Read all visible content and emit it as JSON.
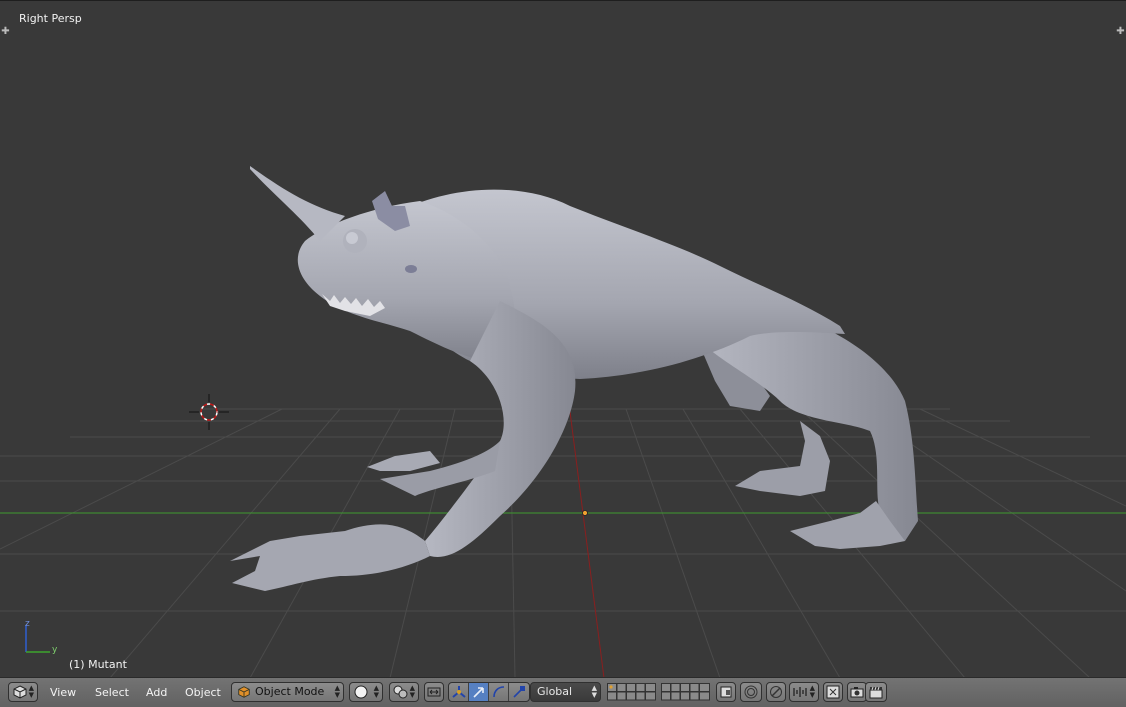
{
  "viewport": {
    "view_label": "Right Persp",
    "object_label": "(1) Mutant",
    "axis_z": "z",
    "axis_y": "y"
  },
  "header": {
    "menus": [
      "View",
      "Select",
      "Add",
      "Object"
    ],
    "mode": "Object Mode",
    "orientation": "Global",
    "icons": {
      "editor_type": "cube-icon",
      "shading": "solid-sphere-icon",
      "pivot": "pivot-point-icon",
      "manipulator_toggle": "manipulator-icon",
      "translate": "translate-arrow-icon",
      "rotate": "rotate-arc-icon",
      "scale": "scale-icon",
      "proportional": "proportional-edit-icon",
      "snap": "magnet-icon",
      "render": "camera-icon",
      "render_anim": "clapboard-icon"
    }
  },
  "colors": {
    "viewport_bg": "#393939",
    "grid_line": "#4d4d4d",
    "x_axis": "#8a1f1f",
    "y_axis": "#3e9a2e",
    "model": "#a7a9b3",
    "header_bg": "#6e6e6e",
    "active_blue": "#5680c2"
  }
}
